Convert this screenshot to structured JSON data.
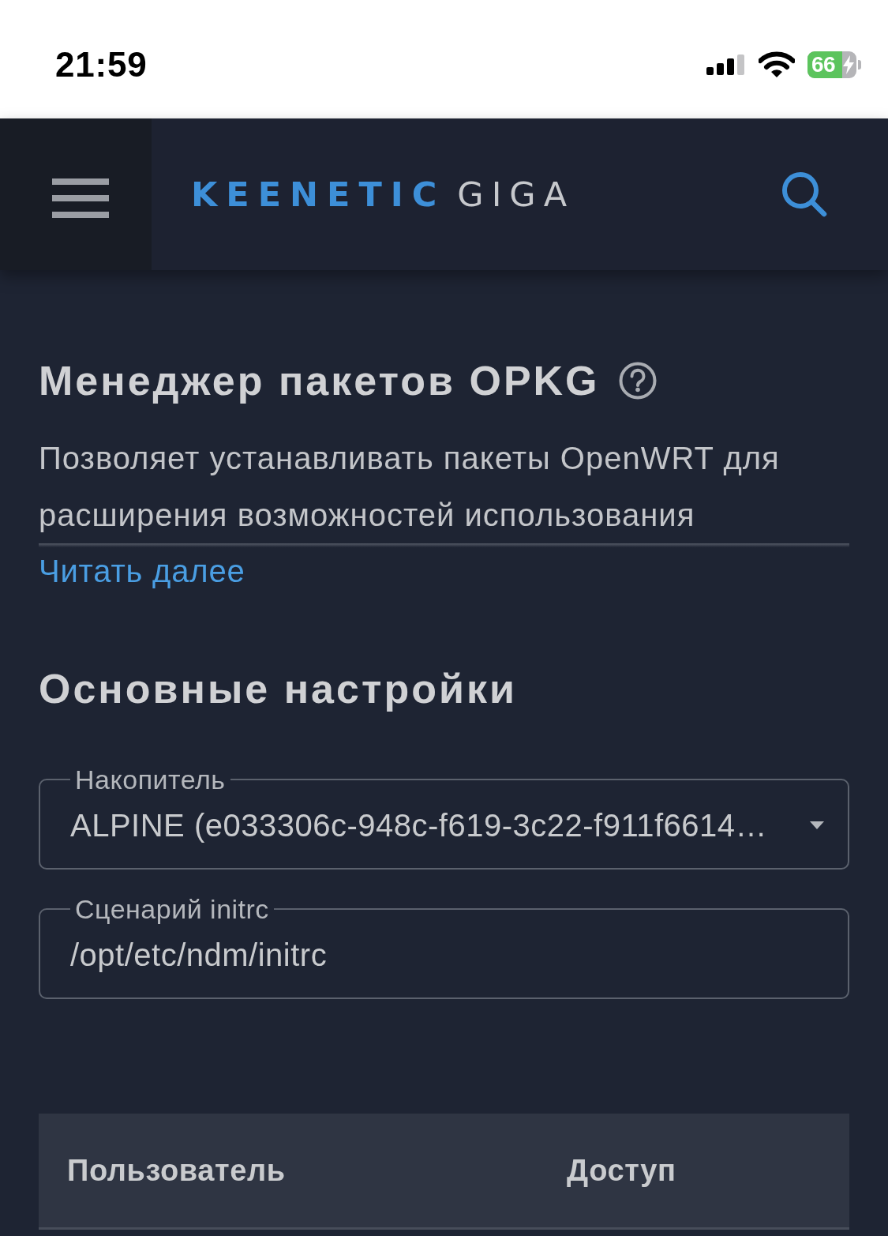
{
  "status_bar": {
    "time": "21:59",
    "battery": "66",
    "charging": true
  },
  "header": {
    "brand": "KEENETIC",
    "model": "GIGA"
  },
  "intro": {
    "title": "Менеджер пакетов OPKG",
    "description": "Позволяет устанавливать пакеты OpenWRT для расширения возможностей использования",
    "expanded": false,
    "more_link": "Читать далее"
  },
  "settings": {
    "title": "Основные настройки",
    "fields": [
      {
        "kind": "select",
        "label": "Накопитель",
        "value": "ALPINE (e033306c-948c-f619-3c22-f911f6614…"
      },
      {
        "kind": "text",
        "label": "Сценарий initrc",
        "value": "/opt/etc/ndm/initrc"
      }
    ]
  },
  "table": {
    "columns": [
      "Пользователь",
      "Доступ"
    ]
  }
}
